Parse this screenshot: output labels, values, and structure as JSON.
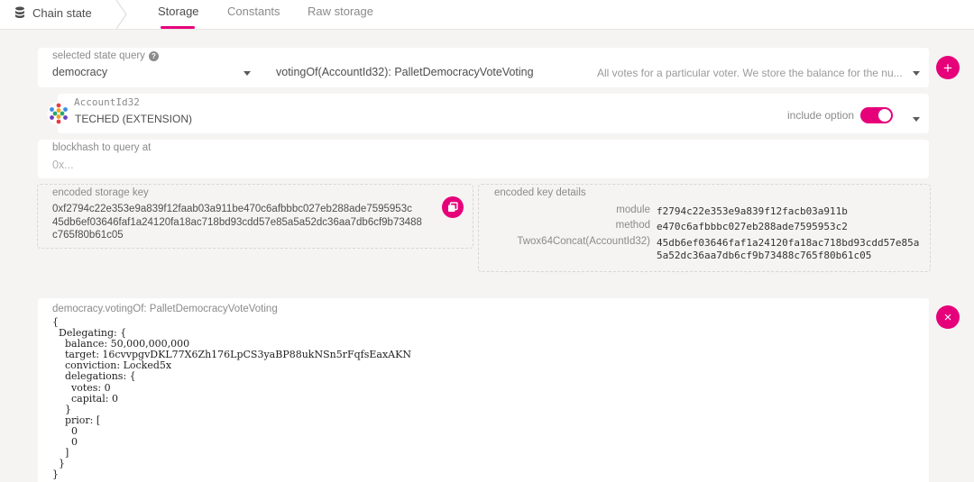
{
  "nav": {
    "brand": "Chain state",
    "tabs": [
      "Storage",
      "Constants",
      "Raw storage"
    ]
  },
  "query": {
    "label": "selected state query",
    "module": "democracy",
    "method": "votingOf(AccountId32): PalletDemocracyVoteVoting",
    "description": "All votes for a particular voter. We store the balance for the nu..."
  },
  "account": {
    "label": "AccountId32",
    "value": "TECHED (EXTENSION)",
    "include_option": "include option"
  },
  "blockhash": {
    "label": "blockhash to query at",
    "placeholder": "0x..."
  },
  "encoded_key": {
    "label": "encoded storage key",
    "lines": [
      "0xf2794c22e353e9a839f12faab03a911be470c6afbbbc027eb288ade7595953c",
      "45db6ef03646faf1a24120fa18ac718bd93cdd57e85a5a52dc36aa7db6cf9b73488",
      "c765f80b61c05"
    ]
  },
  "key_details": {
    "label": "encoded key details",
    "module_key": "module",
    "module_val": "f2794c22e353e9a839f12facb03a911b",
    "method_key": "method",
    "method_val": "e470c6afbbbc027eb288ade7595953c2",
    "hasher_key": "Twox64Concat(AccountId32)",
    "hasher_val_1": "45db6ef03646faf1a24120fa18ac718bd93cdd57e85a",
    "hasher_val_2": "5a52dc36aa7db6cf9b73488c765f80b61c05"
  },
  "result": {
    "title": "democracy.votingOf: PalletDemocracyVoteVoting",
    "body": "{\n  Delegating: {\n    balance: 50,000,000,000\n    target: 16cvvpgvDKL77X6Zh176LpCS3yaBP88ukNSn5rFqfsEaxAKN\n    conviction: Locked5x\n    delegations: {\n      votes: 0\n      capital: 0\n    }\n    prior: [\n      0\n      0\n    ]\n  }\n}"
  },
  "colors": {
    "accent": "#e6007a",
    "background": "#f5f4f3"
  }
}
